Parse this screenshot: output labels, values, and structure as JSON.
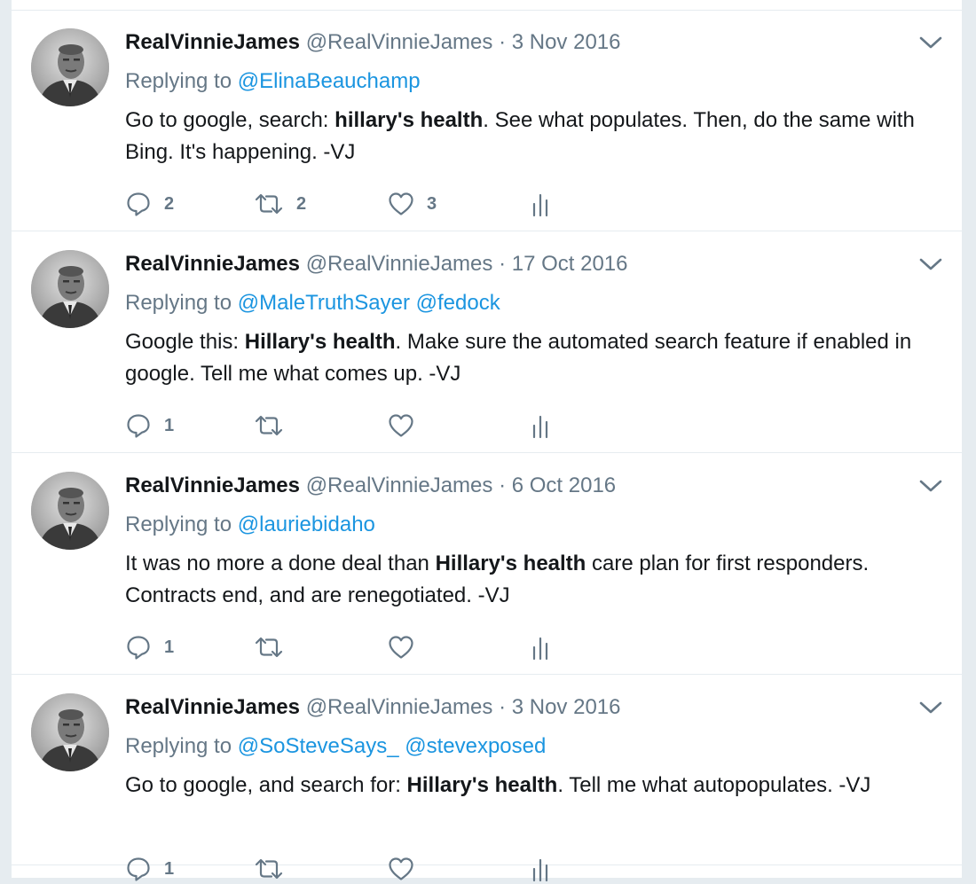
{
  "tweets": [
    {
      "name": "RealVinnieJames",
      "handle": "@RealVinnieJames",
      "dot": "·",
      "date": "3 Nov 2016",
      "replying_prefix": "Replying to",
      "mentions": [
        "@ElinaBeauchamp"
      ],
      "text": {
        "before": "Go to google, search: ",
        "bold": "hillary's health",
        "after": ". See what populates. Then, do the same with Bing. It's happening. -VJ"
      },
      "counts": {
        "replies": "2",
        "retweets": "2",
        "likes": "3"
      }
    },
    {
      "name": "RealVinnieJames",
      "handle": "@RealVinnieJames",
      "dot": "·",
      "date": "17 Oct 2016",
      "replying_prefix": "Replying to",
      "mentions": [
        "@MaleTruthSayer",
        "@fedock"
      ],
      "text": {
        "before": "Google this: ",
        "bold": "Hillary's health",
        "after": ". Make sure the automated search feature if enabled in google. Tell me what comes up. -VJ"
      },
      "counts": {
        "replies": "1",
        "retweets": "",
        "likes": ""
      }
    },
    {
      "name": "RealVinnieJames",
      "handle": "@RealVinnieJames",
      "dot": "·",
      "date": "6 Oct 2016",
      "replying_prefix": "Replying to",
      "mentions": [
        "@lauriebidaho"
      ],
      "text": {
        "before": "It was no more a done deal than ",
        "bold": "Hillary's health",
        "after": " care plan for first responders. Contracts end, and are renegotiated. -VJ"
      },
      "counts": {
        "replies": "1",
        "retweets": "",
        "likes": ""
      }
    },
    {
      "name": "RealVinnieJames",
      "handle": "@RealVinnieJames",
      "dot": "·",
      "date": "3 Nov 2016",
      "replying_prefix": "Replying to",
      "mentions": [
        "@SoSteveSays_",
        "@stevexposed"
      ],
      "text": {
        "before": "Go to google, and search for: ",
        "bold": "Hillary's health",
        "after": ". Tell me what autopopulates. -VJ"
      },
      "counts": {
        "replies": "1",
        "retweets": "",
        "likes": ""
      }
    }
  ],
  "icons": {
    "reply": "reply-icon",
    "retweet": "retweet-icon",
    "like": "heart-icon",
    "analytics": "analytics-icon",
    "caret": "chevron-down-icon",
    "avatar": "avatar"
  },
  "colors": {
    "link": "#1b95e0",
    "secondary": "#657786",
    "text": "#14171a",
    "border": "#e6ecf0",
    "background": "#e6ecf0"
  }
}
